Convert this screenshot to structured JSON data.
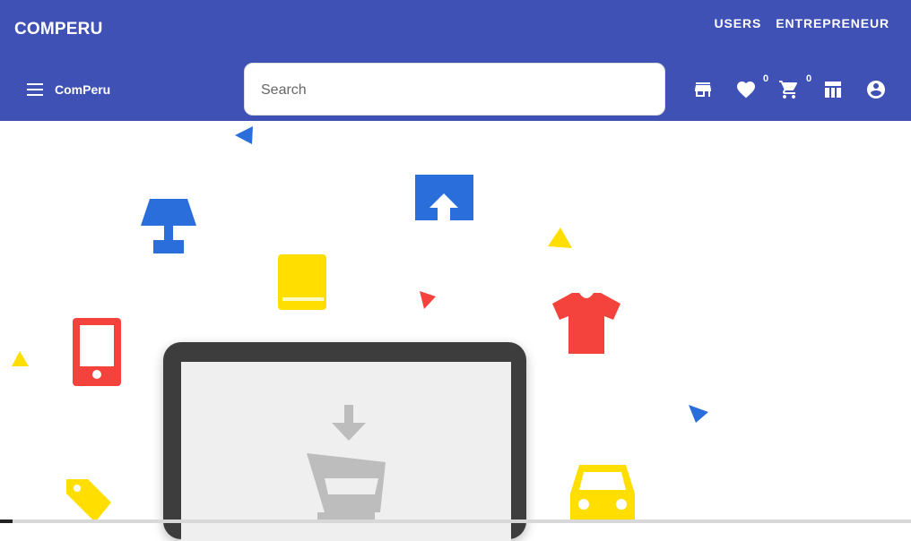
{
  "topbar": {
    "brand": "COMPERU",
    "links": [
      "USERS",
      "ENTREPRENEUR"
    ]
  },
  "toolbar": {
    "brand": "ComPeru",
    "search": {
      "placeholder": "Search",
      "value": ""
    },
    "icons": [
      "store-icon",
      "heart-icon",
      "cart-icon",
      "dashboard-icon",
      "account-circle-icon"
    ],
    "wishlist_count": "0",
    "cart_count": "0"
  },
  "hero": {
    "decorations": [
      "triangle-blue",
      "lamp-icon",
      "upload-icon",
      "triangle-yellow",
      "book-icon",
      "triangle-red",
      "tshirt-icon",
      "phone-icon",
      "triangle-yellow",
      "triangle-blue",
      "tag-icon",
      "car-icon",
      "laptop-illustration",
      "cart-download-icon"
    ]
  },
  "colors": {
    "primary": "#3f51b5",
    "blue": "#2a6edb",
    "yellow": "#ffde00",
    "red": "#f4433c",
    "dark": "#3d3d3d",
    "gray": "#bdbdbd"
  }
}
